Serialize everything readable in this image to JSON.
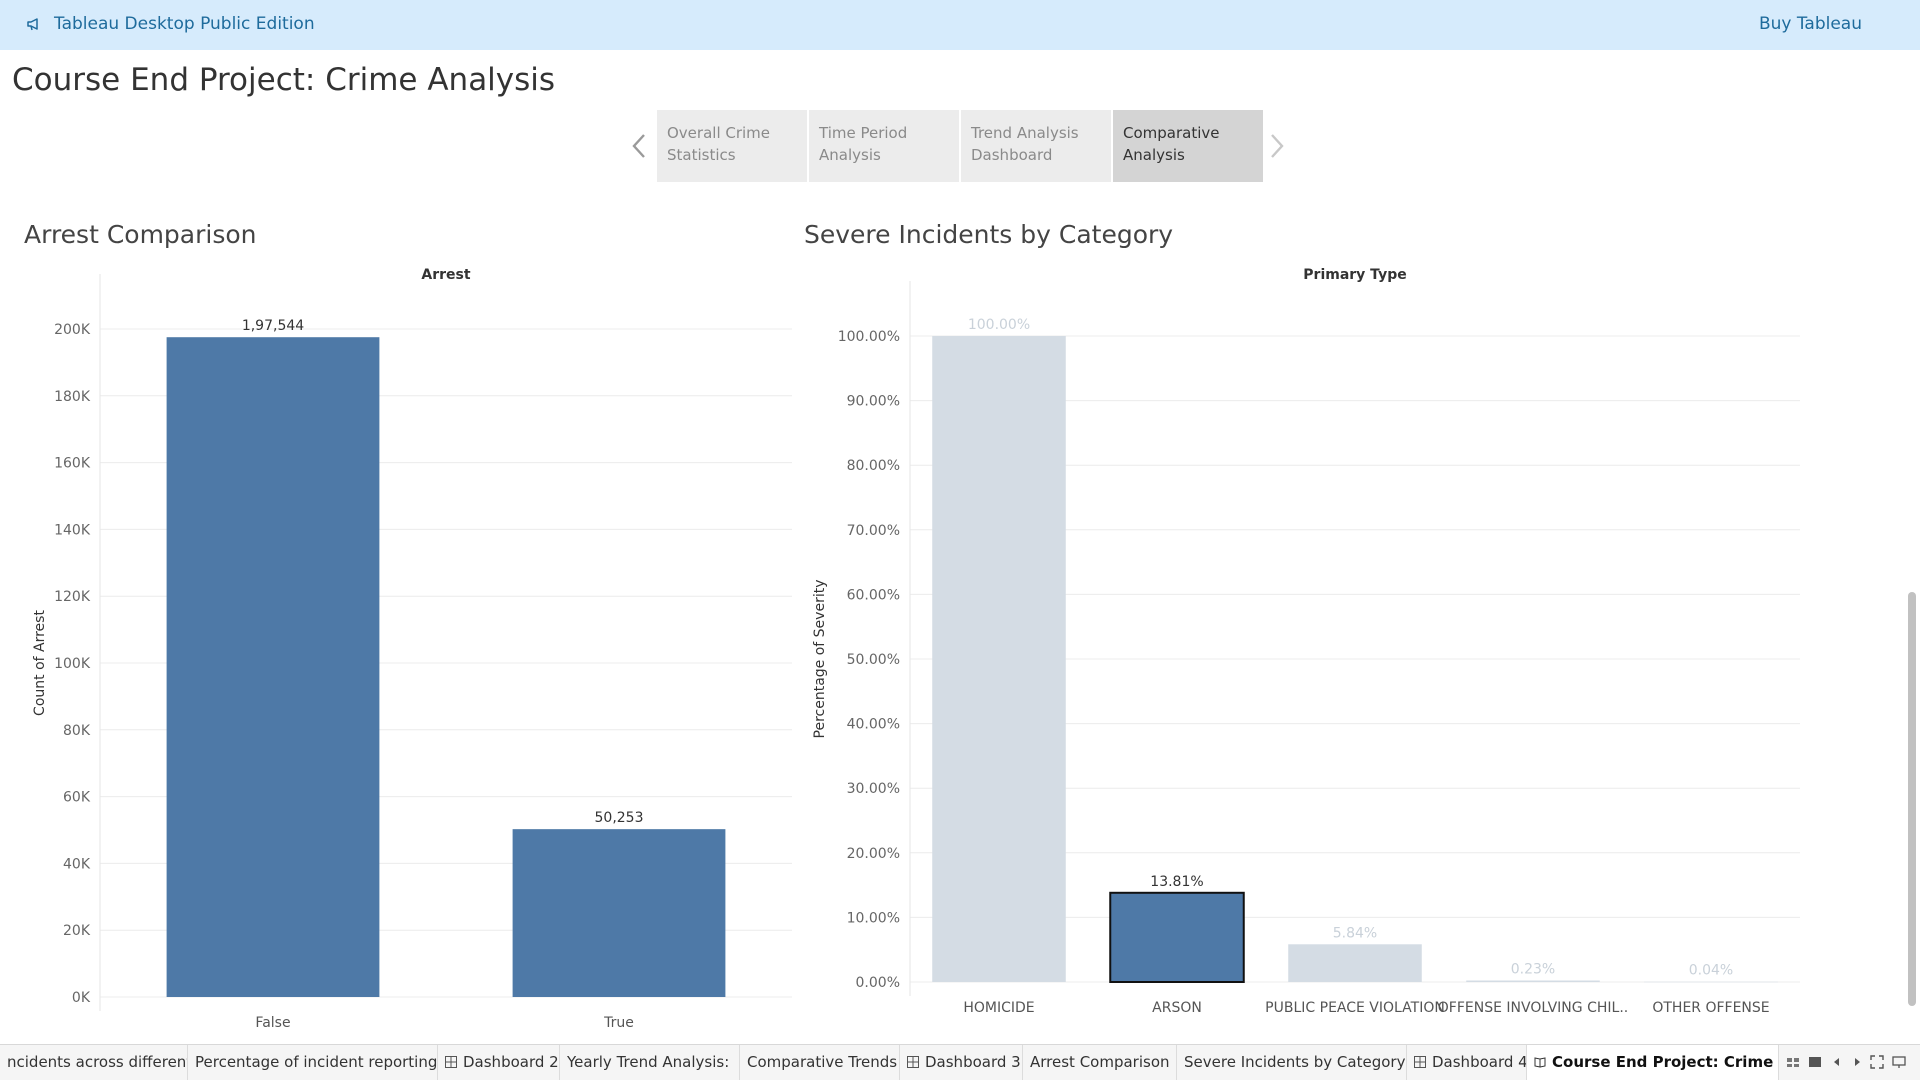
{
  "app": {
    "title": "Tableau Desktop Public Edition",
    "buy_label": "Buy Tableau",
    "accent_color": "#1e6b9c",
    "topbar_color": "#d6ebfc",
    "icon": "megaphone-icon"
  },
  "page": {
    "title": "Course End Project: Crime Analysis"
  },
  "story": {
    "points": [
      {
        "line1": "Overall Crime",
        "line2": "Statistics",
        "active": false
      },
      {
        "line1": "Time Period",
        "line2": "Analysis",
        "active": false
      },
      {
        "line1": "Trend Analysis",
        "line2": "Dashboard",
        "active": false
      },
      {
        "line1": "Comparative",
        "line2": "Analysis",
        "active": true
      }
    ],
    "prev_icon": "chevron-left-icon",
    "next_icon": "chevron-right-icon"
  },
  "arrest_chart": {
    "sheet_title": "Arrest Comparison"
  },
  "severity_chart": {
    "sheet_title": "Severe Incidents by Category"
  },
  "chart_data": [
    {
      "type": "bar",
      "title": "Arrest Comparison",
      "header": "Arrest",
      "ylabel": "Count of Arrest",
      "xlabel": "",
      "categories": [
        "False",
        "True"
      ],
      "values": [
        197544,
        50253
      ],
      "data_labels": [
        "1,97,544",
        "50,253"
      ],
      "ylim": [
        0,
        200000
      ],
      "yticks": [
        0,
        20000,
        40000,
        60000,
        80000,
        100000,
        120000,
        140000,
        160000,
        180000,
        200000
      ],
      "ytick_labels": [
        "0K",
        "20K",
        "40K",
        "60K",
        "80K",
        "100K",
        "120K",
        "140K",
        "160K",
        "180K",
        "200K"
      ],
      "bar_color": "#4e79a7",
      "grid": true
    },
    {
      "type": "bar",
      "title": "Severe Incidents by Category",
      "header": "Primary Type",
      "ylabel": "Percentage of Severity",
      "xlabel": "",
      "categories": [
        "HOMICIDE",
        "ARSON",
        "PUBLIC PEACE VIOLATION",
        "OFFENSE INVOLVING CHIL..",
        "OTHER OFFENSE"
      ],
      "values": [
        100.0,
        13.81,
        5.84,
        0.23,
        0.04
      ],
      "data_labels": [
        "100.00%",
        "13.81%",
        "5.84%",
        "0.23%",
        "0.04%"
      ],
      "highlighted_index": 1,
      "ylim": [
        0,
        100
      ],
      "yticks": [
        0,
        10,
        20,
        30,
        40,
        50,
        60,
        70,
        80,
        90,
        100
      ],
      "ytick_labels": [
        "0.00%",
        "10.00%",
        "20.00%",
        "30.00%",
        "40.00%",
        "50.00%",
        "60.00%",
        "70.00%",
        "80.00%",
        "90.00%",
        "100.00%"
      ],
      "bar_color": "#4e79a7",
      "dim_color": "#d4dce4",
      "grid": true
    }
  ],
  "tabs": [
    {
      "label": "ncidents across different ...",
      "icon": "",
      "active": false
    },
    {
      "label": "Percentage of incident reporting...",
      "icon": "",
      "active": false
    },
    {
      "label": "Dashboard 2",
      "icon": "dashboard-icon",
      "active": false
    },
    {
      "label": "Yearly Trend Analysis:",
      "icon": "",
      "active": false
    },
    {
      "label": "Comparative Trends",
      "icon": "",
      "active": false
    },
    {
      "label": "Dashboard 3",
      "icon": "dashboard-icon",
      "active": false
    },
    {
      "label": "Arrest Comparison",
      "icon": "",
      "active": false
    },
    {
      "label": "Severe Incidents by Category",
      "icon": "",
      "active": false
    },
    {
      "label": "Dashboard 4",
      "icon": "dashboard-icon",
      "active": false
    },
    {
      "label": "Course End Project: Crime A...",
      "icon": "story-icon",
      "active": true
    }
  ],
  "tab_controls": [
    "sheet-sorter-icon",
    "film-strip-icon",
    "scroll-left-icon",
    "scroll-right-icon",
    "fullscreen-icon",
    "presentation-icon"
  ]
}
